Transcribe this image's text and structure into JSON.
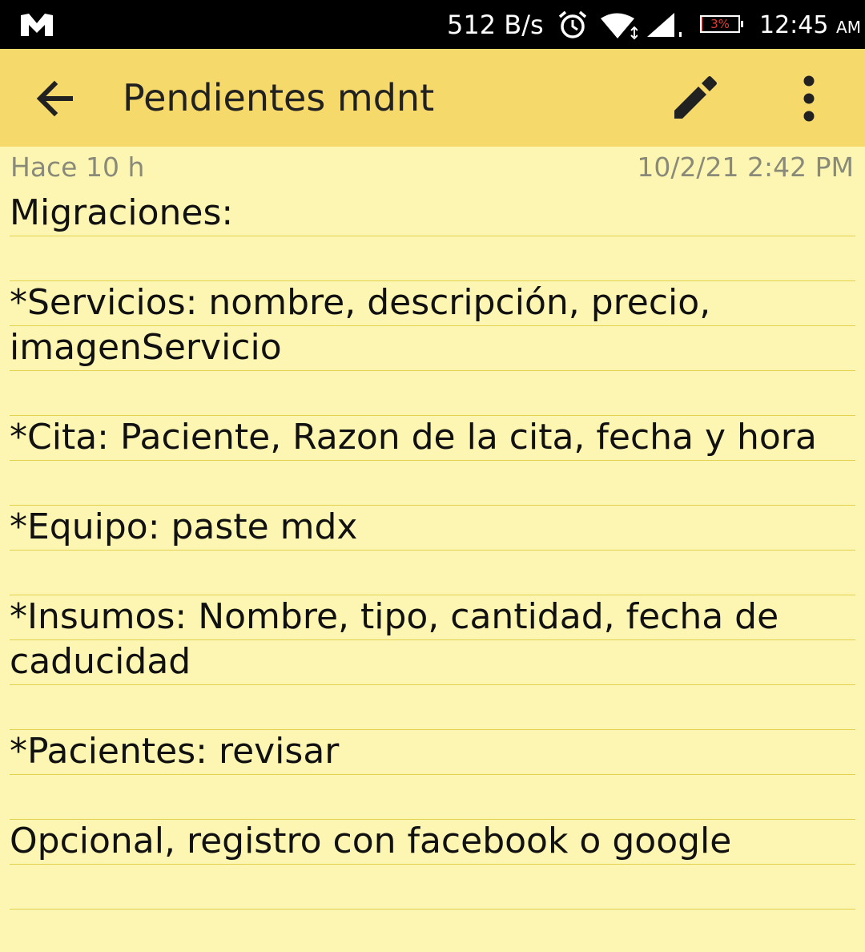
{
  "status_bar": {
    "network_speed": "512 B/s",
    "battery_text": "3%",
    "battery_level_percent": 3,
    "time": "12:45",
    "ampm": "AM",
    "icons": [
      "app-logo-icon",
      "alarm-icon",
      "wifi-icon",
      "signal-icon",
      "battery-icon"
    ]
  },
  "app_bar": {
    "title": "Pendientes mdnt",
    "background_color": "#f5d96b",
    "icons": [
      "back-arrow-icon",
      "pencil-edit-icon",
      "more-vert-icon"
    ]
  },
  "note": {
    "relative_time": "Hace 10 h",
    "timestamp": "10/2/21 2:42 PM",
    "background_color": "#fdf6b3",
    "lines": [
      "Migraciones:",
      "",
      "*Servicios: nombre, descripción, precio,",
      "imagenServicio",
      "",
      "*Cita: Paciente, Razon de la cita, fecha y hora",
      "",
      "*Equipo: paste mdx",
      "",
      "*Insumos: Nombre, tipo, cantidad, fecha de",
      "caducidad",
      "",
      "*Pacientes: revisar",
      "",
      "Opcional, registro con facebook o google",
      ""
    ]
  }
}
